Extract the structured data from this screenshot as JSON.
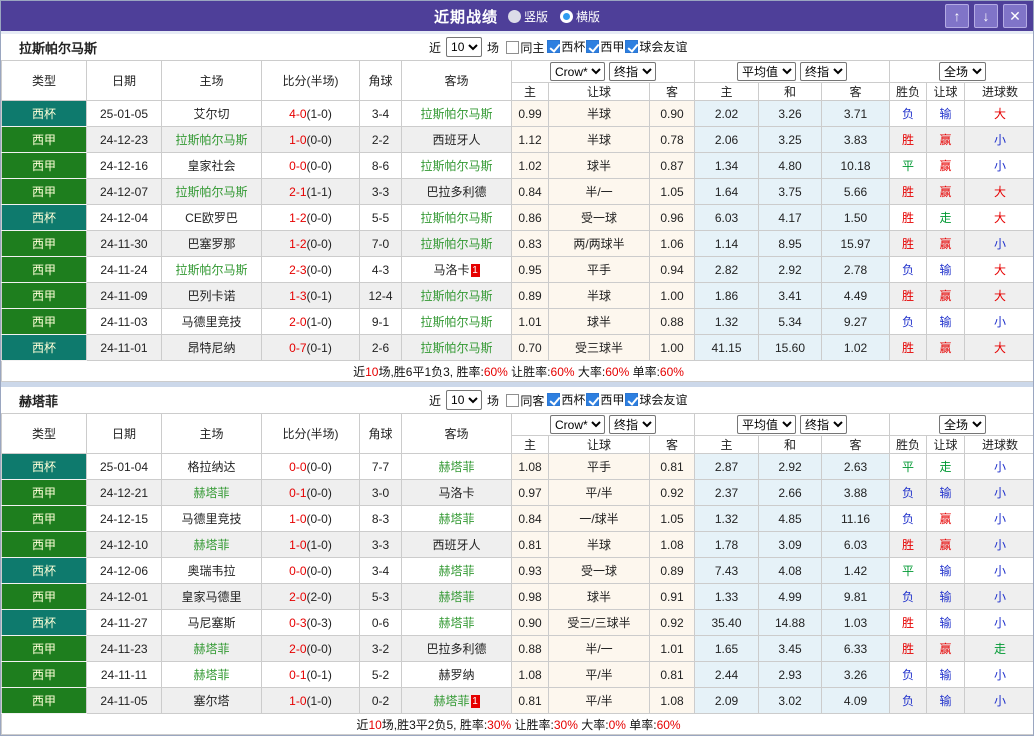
{
  "titlebar": {
    "title": "近期战绩",
    "radio_vertical": "竖版",
    "radio_horizontal": "横版",
    "buttons": {
      "up": "↑",
      "down": "↓",
      "close": "✕"
    }
  },
  "colors": {
    "titlebar_bg": "#4e3f99",
    "cup_type_bg": "#0e7a6d",
    "league_type_bg": "#1e7e1e",
    "subject_team_green": "#339933",
    "win_red": "#e60000",
    "draw_green": "#009933",
    "lose_blue": "#2233cc",
    "asia_odds_bg": "#fdf7ee",
    "europe_odds_bg": "#e6f2f8",
    "row_stripe": "#efefef"
  },
  "headers": {
    "type": "类型",
    "date": "日期",
    "home": "主场",
    "score": "比分(半场)",
    "corner": "角球",
    "away": "客场",
    "selects": {
      "crow": "Crow*",
      "final": "终指",
      "avg": "平均值",
      "full": "全场"
    },
    "asia_home": "主",
    "asia_handicap": "让球",
    "asia_away": "客",
    "eu_home": "主",
    "eu_draw": "和",
    "eu_away": "客",
    "result": "胜负",
    "result_handicap": "让球",
    "result_goals": "进球数"
  },
  "tables": [
    {
      "team": "拉斯帕尔马斯",
      "filter": {
        "near": "近",
        "count": "10",
        "unit": "场",
        "same_label": "同主",
        "leagues": [
          "西杯",
          "西甲",
          "球会友谊"
        ]
      },
      "rows": [
        {
          "type": "西杯",
          "date": "25-01-05",
          "home": "艾尔切",
          "home_active": false,
          "home_card": "",
          "ft": "4-0",
          "ht": "(1-0)",
          "corner": "3-4",
          "away": "拉斯帕尔马斯",
          "away_active": true,
          "away_card": "",
          "asia": [
            "0.99",
            "半球",
            "0.90"
          ],
          "europe": [
            "2.02",
            "3.26",
            "3.71"
          ],
          "outcome": [
            "负",
            "输",
            "大"
          ]
        },
        {
          "type": "西甲",
          "date": "24-12-23",
          "home": "拉斯帕尔马斯",
          "home_active": true,
          "home_card": "",
          "ft": "1-0",
          "ht": "(0-0)",
          "corner": "2-2",
          "away": "西班牙人",
          "away_active": false,
          "away_card": "",
          "asia": [
            "1.12",
            "半球",
            "0.78"
          ],
          "europe": [
            "2.06",
            "3.25",
            "3.83"
          ],
          "outcome": [
            "胜",
            "赢",
            "小"
          ]
        },
        {
          "type": "西甲",
          "date": "24-12-16",
          "home": "皇家社会",
          "home_active": false,
          "home_card": "",
          "ft": "0-0",
          "ht": "(0-0)",
          "corner": "8-6",
          "away": "拉斯帕尔马斯",
          "away_active": true,
          "away_card": "",
          "asia": [
            "1.02",
            "球半",
            "0.87"
          ],
          "europe": [
            "1.34",
            "4.80",
            "10.18"
          ],
          "outcome": [
            "平",
            "赢",
            "小"
          ]
        },
        {
          "type": "西甲",
          "date": "24-12-07",
          "home": "拉斯帕尔马斯",
          "home_active": true,
          "home_card": "",
          "ft": "2-1",
          "ht": "(1-1)",
          "corner": "3-3",
          "away": "巴拉多利德",
          "away_active": false,
          "away_card": "",
          "asia": [
            "0.84",
            "半/一",
            "1.05"
          ],
          "europe": [
            "1.64",
            "3.75",
            "5.66"
          ],
          "outcome": [
            "胜",
            "赢",
            "大"
          ]
        },
        {
          "type": "西杯",
          "date": "24-12-04",
          "home": "CE欧罗巴",
          "home_active": false,
          "home_card": "",
          "ft": "1-2",
          "ht": "(0-0)",
          "corner": "5-5",
          "away": "拉斯帕尔马斯",
          "away_active": true,
          "away_card": "",
          "asia": [
            "0.86",
            "受一球",
            "0.96"
          ],
          "europe": [
            "6.03",
            "4.17",
            "1.50"
          ],
          "outcome": [
            "胜",
            "走",
            "大"
          ]
        },
        {
          "type": "西甲",
          "date": "24-11-30",
          "home": "巴塞罗那",
          "home_active": false,
          "home_card": "",
          "ft": "1-2",
          "ht": "(0-0)",
          "corner": "7-0",
          "away": "拉斯帕尔马斯",
          "away_active": true,
          "away_card": "",
          "asia": [
            "0.83",
            "两/两球半",
            "1.06"
          ],
          "europe": [
            "1.14",
            "8.95",
            "15.97"
          ],
          "outcome": [
            "胜",
            "赢",
            "小"
          ]
        },
        {
          "type": "西甲",
          "date": "24-11-24",
          "home": "拉斯帕尔马斯",
          "home_active": true,
          "home_card": "",
          "ft": "2-3",
          "ht": "(0-0)",
          "corner": "4-3",
          "away": "马洛卡",
          "away_active": false,
          "away_card": "1",
          "asia": [
            "0.95",
            "平手",
            "0.94"
          ],
          "europe": [
            "2.82",
            "2.92",
            "2.78"
          ],
          "outcome": [
            "负",
            "输",
            "大"
          ]
        },
        {
          "type": "西甲",
          "date": "24-11-09",
          "home": "巴列卡诺",
          "home_active": false,
          "home_card": "",
          "ft": "1-3",
          "ht": "(0-1)",
          "corner": "12-4",
          "away": "拉斯帕尔马斯",
          "away_active": true,
          "away_card": "",
          "asia": [
            "0.89",
            "半球",
            "1.00"
          ],
          "europe": [
            "1.86",
            "3.41",
            "4.49"
          ],
          "outcome": [
            "胜",
            "赢",
            "大"
          ]
        },
        {
          "type": "西甲",
          "date": "24-11-03",
          "home": "马德里竞技",
          "home_active": false,
          "home_card": "",
          "ft": "2-0",
          "ht": "(1-0)",
          "corner": "9-1",
          "away": "拉斯帕尔马斯",
          "away_active": true,
          "away_card": "",
          "asia": [
            "1.01",
            "球半",
            "0.88"
          ],
          "europe": [
            "1.32",
            "5.34",
            "9.27"
          ],
          "outcome": [
            "负",
            "输",
            "小"
          ]
        },
        {
          "type": "西杯",
          "date": "24-11-01",
          "home": "昂特尼纳",
          "home_active": false,
          "home_card": "",
          "ft": "0-7",
          "ht": "(0-1)",
          "corner": "2-6",
          "away": "拉斯帕尔马斯",
          "away_active": true,
          "away_card": "",
          "asia": [
            "0.70",
            "受三球半",
            "1.00"
          ],
          "europe": [
            "41.15",
            "15.60",
            "1.02"
          ],
          "outcome": [
            "胜",
            "赢",
            "大"
          ]
        }
      ],
      "summary_segments": [
        [
          "近",
          "b"
        ],
        [
          "10",
          "r"
        ],
        [
          "场,胜6平1负3, 胜率:",
          "b"
        ],
        [
          "60%",
          "r"
        ],
        [
          " 让胜率:",
          "b"
        ],
        [
          "60%",
          "r"
        ],
        [
          " 大率:",
          "b"
        ],
        [
          "60%",
          "r"
        ],
        [
          " 单率:",
          "b"
        ],
        [
          "60%",
          "r"
        ]
      ]
    },
    {
      "team": "赫塔菲",
      "filter": {
        "near": "近",
        "count": "10",
        "unit": "场",
        "same_label": "同客",
        "leagues": [
          "西杯",
          "西甲",
          "球会友谊"
        ]
      },
      "rows": [
        {
          "type": "西杯",
          "date": "25-01-04",
          "home": "格拉纳达",
          "home_active": false,
          "home_card": "",
          "ft": "0-0",
          "ht": "(0-0)",
          "corner": "7-7",
          "away": "赫塔菲",
          "away_active": true,
          "away_card": "",
          "asia": [
            "1.08",
            "平手",
            "0.81"
          ],
          "europe": [
            "2.87",
            "2.92",
            "2.63"
          ],
          "outcome": [
            "平",
            "走",
            "小"
          ]
        },
        {
          "type": "西甲",
          "date": "24-12-21",
          "home": "赫塔菲",
          "home_active": true,
          "home_card": "",
          "ft": "0-1",
          "ht": "(0-0)",
          "corner": "3-0",
          "away": "马洛卡",
          "away_active": false,
          "away_card": "",
          "asia": [
            "0.97",
            "平/半",
            "0.92"
          ],
          "europe": [
            "2.37",
            "2.66",
            "3.88"
          ],
          "outcome": [
            "负",
            "输",
            "小"
          ]
        },
        {
          "type": "西甲",
          "date": "24-12-15",
          "home": "马德里竞技",
          "home_active": false,
          "home_card": "",
          "ft": "1-0",
          "ht": "(0-0)",
          "corner": "8-3",
          "away": "赫塔菲",
          "away_active": true,
          "away_card": "",
          "asia": [
            "0.84",
            "一/球半",
            "1.05"
          ],
          "europe": [
            "1.32",
            "4.85",
            "11.16"
          ],
          "outcome": [
            "负",
            "赢",
            "小"
          ]
        },
        {
          "type": "西甲",
          "date": "24-12-10",
          "home": "赫塔菲",
          "home_active": true,
          "home_card": "",
          "ft": "1-0",
          "ht": "(1-0)",
          "corner": "3-3",
          "away": "西班牙人",
          "away_active": false,
          "away_card": "",
          "asia": [
            "0.81",
            "半球",
            "1.08"
          ],
          "europe": [
            "1.78",
            "3.09",
            "6.03"
          ],
          "outcome": [
            "胜",
            "赢",
            "小"
          ]
        },
        {
          "type": "西杯",
          "date": "24-12-06",
          "home": "奥瑞韦拉",
          "home_active": false,
          "home_card": "",
          "ft": "0-0",
          "ht": "(0-0)",
          "corner": "3-4",
          "away": "赫塔菲",
          "away_active": true,
          "away_card": "",
          "asia": [
            "0.93",
            "受一球",
            "0.89"
          ],
          "europe": [
            "7.43",
            "4.08",
            "1.42"
          ],
          "outcome": [
            "平",
            "输",
            "小"
          ]
        },
        {
          "type": "西甲",
          "date": "24-12-01",
          "home": "皇家马德里",
          "home_active": false,
          "home_card": "",
          "ft": "2-0",
          "ht": "(2-0)",
          "corner": "5-3",
          "away": "赫塔菲",
          "away_active": true,
          "away_card": "",
          "asia": [
            "0.98",
            "球半",
            "0.91"
          ],
          "europe": [
            "1.33",
            "4.99",
            "9.81"
          ],
          "outcome": [
            "负",
            "输",
            "小"
          ]
        },
        {
          "type": "西杯",
          "date": "24-11-27",
          "home": "马尼塞斯",
          "home_active": false,
          "home_card": "",
          "ft": "0-3",
          "ht": "(0-3)",
          "corner": "0-6",
          "away": "赫塔菲",
          "away_active": true,
          "away_card": "",
          "asia": [
            "0.90",
            "受三/三球半",
            "0.92"
          ],
          "europe": [
            "35.40",
            "14.88",
            "1.03"
          ],
          "outcome": [
            "胜",
            "输",
            "小"
          ]
        },
        {
          "type": "西甲",
          "date": "24-11-23",
          "home": "赫塔菲",
          "home_active": true,
          "home_card": "",
          "ft": "2-0",
          "ht": "(0-0)",
          "corner": "3-2",
          "away": "巴拉多利德",
          "away_active": false,
          "away_card": "",
          "asia": [
            "0.88",
            "半/一",
            "1.01"
          ],
          "europe": [
            "1.65",
            "3.45",
            "6.33"
          ],
          "outcome": [
            "胜",
            "赢",
            "走"
          ]
        },
        {
          "type": "西甲",
          "date": "24-11-11",
          "home": "赫塔菲",
          "home_active": true,
          "home_card": "",
          "ft": "0-1",
          "ht": "(0-1)",
          "corner": "5-2",
          "away": "赫罗纳",
          "away_active": false,
          "away_card": "",
          "asia": [
            "1.08",
            "平/半",
            "0.81"
          ],
          "europe": [
            "2.44",
            "2.93",
            "3.26"
          ],
          "outcome": [
            "负",
            "输",
            "小"
          ]
        },
        {
          "type": "西甲",
          "date": "24-11-05",
          "home": "塞尔塔",
          "home_active": false,
          "home_card": "",
          "ft": "1-0",
          "ht": "(1-0)",
          "corner": "0-2",
          "away": "赫塔菲",
          "away_active": true,
          "away_card": "1",
          "asia": [
            "0.81",
            "平/半",
            "1.08"
          ],
          "europe": [
            "2.09",
            "3.02",
            "4.09"
          ],
          "outcome": [
            "负",
            "输",
            "小"
          ]
        }
      ],
      "summary_segments": [
        [
          "近",
          "b"
        ],
        [
          "10",
          "r"
        ],
        [
          "场,胜3平2负5, 胜率:",
          "b"
        ],
        [
          "30%",
          "r"
        ],
        [
          " 让胜率:",
          "b"
        ],
        [
          "30%",
          "r"
        ],
        [
          " 大率:",
          "b"
        ],
        [
          "0%",
          "r"
        ],
        [
          " 单率:",
          "b"
        ],
        [
          "60%",
          "r"
        ]
      ]
    }
  ]
}
